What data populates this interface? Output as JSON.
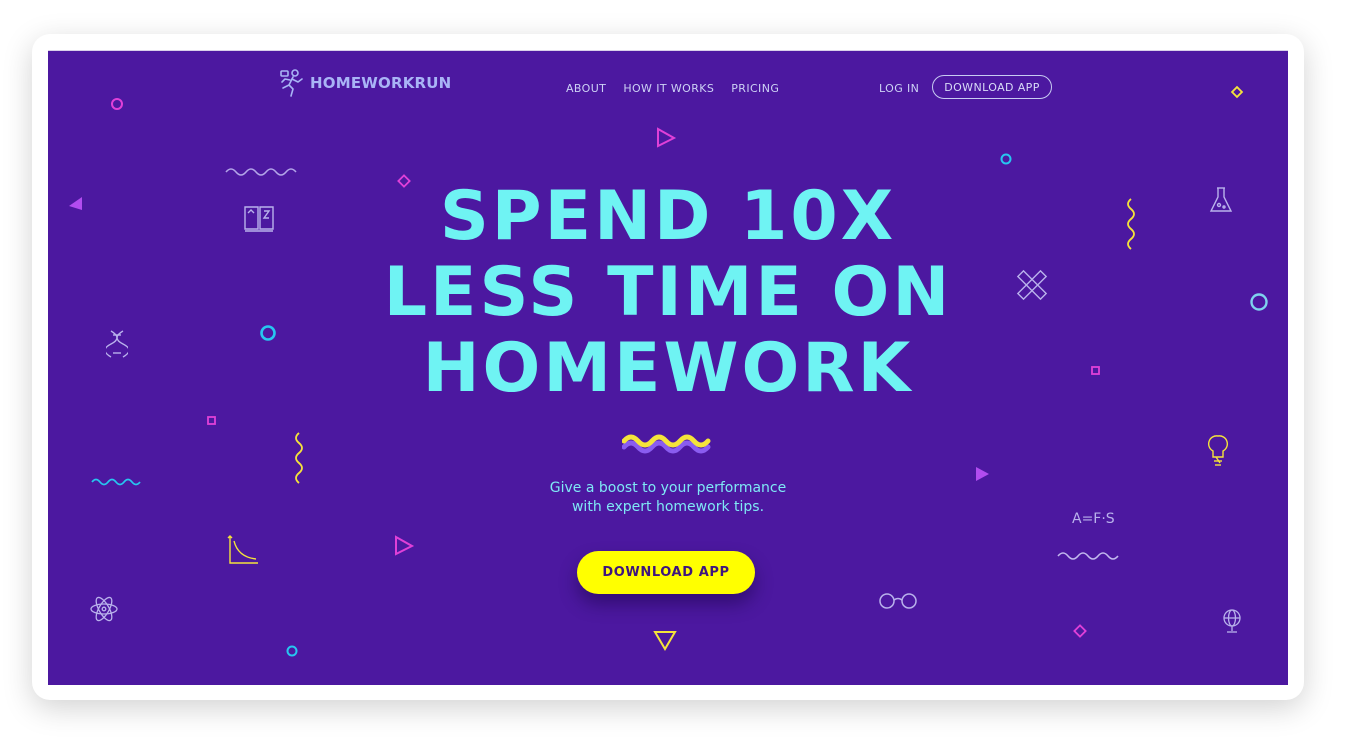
{
  "brand": {
    "name": "HOMEWORKRUN",
    "icon": "runner-logo-icon"
  },
  "nav": {
    "links": [
      {
        "label": "ABOUT"
      },
      {
        "label": "HOW IT WORKS"
      },
      {
        "label": "PRICING"
      }
    ],
    "login_label": "LOG IN",
    "download_label": "DOWNLOAD APP"
  },
  "hero": {
    "headline_lines": [
      "SPEND 10X",
      "LESS TIME ON",
      "HOMEWORK"
    ],
    "tagline_line1": "Give a boost to your performance",
    "tagline_line2": "with expert homework tips.",
    "cta_label": "DOWNLOAD APP"
  },
  "decor": {
    "formula": "A=F·S"
  },
  "colors": {
    "background": "#4c18a0",
    "headline": "#6ff3f3",
    "cta": "#ffff00",
    "accent_magenta": "#e040d8",
    "accent_cyan": "#27c6f0",
    "accent_yellow": "#f5e43a"
  }
}
